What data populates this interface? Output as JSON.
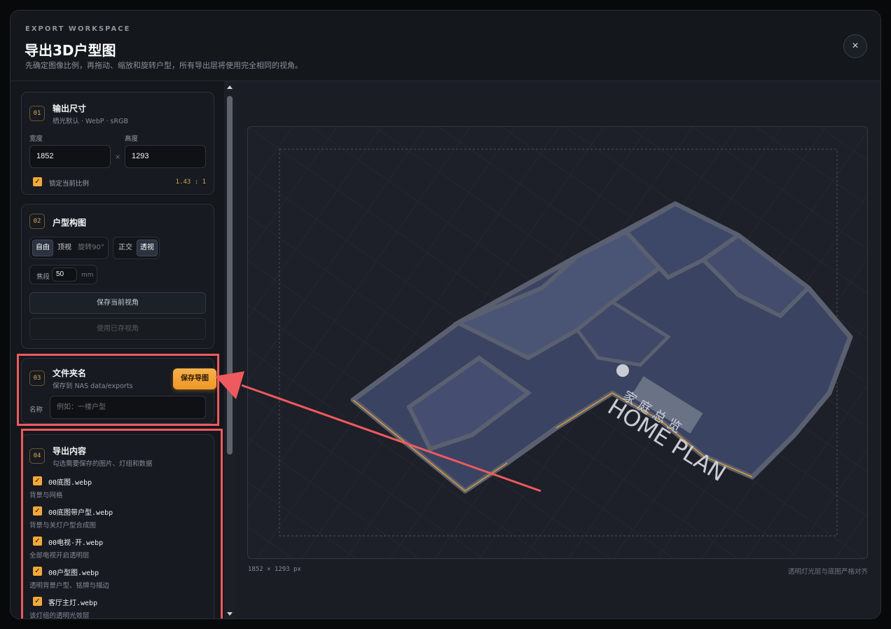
{
  "header": {
    "eyebrow": "EXPORT WORKSPACE",
    "title": "导出3D户型图",
    "subtitle": "先确定图像比例，再拖动、缩放和旋转户型，所有导出层将使用完全相同的视角。",
    "close_label": "×"
  },
  "output_size": {
    "step": "01",
    "title": "输出尺寸",
    "subtitle": "栖光默认 · WebP · sRGB",
    "width_label": "宽度",
    "width_value": "1852",
    "height_label": "高度",
    "height_value": "1293",
    "times": "×",
    "lock_label": "锁定当前比例",
    "lock_checked": true,
    "ratio": "1.43 : 1"
  },
  "composition": {
    "step": "02",
    "title": "户型构图",
    "mode_buttons": [
      "自由",
      "顶视",
      "旋转90°"
    ],
    "active_mode": "自由",
    "projection_buttons": [
      "正交",
      "透视"
    ],
    "active_projection": "透视",
    "focal_label": "焦段",
    "focal_value": "50",
    "focal_unit": "mm",
    "save_view_label": "保存当前视角",
    "use_saved_label": "使用已存视角"
  },
  "folder": {
    "step": "03",
    "title": "文件夹名",
    "subtitle": "保存到 NAS data/exports",
    "save_button": "保存导图",
    "name_label": "名称",
    "name_placeholder": "例如：一楼户型"
  },
  "export_content": {
    "step": "04",
    "title": "导出内容",
    "subtitle": "勾选需要保存的图片、灯组和数据",
    "items": [
      {
        "name": "00底图.webp",
        "desc": "背景与网格",
        "checked": true
      },
      {
        "name": "00底图带户型.webp",
        "desc": "背景与关灯户型合成图",
        "checked": true
      },
      {
        "name": "00电视-开.webp",
        "desc": "全部电视开启透明层",
        "checked": true
      },
      {
        "name": "00户型图.webp",
        "desc": "透明背景户型、铭牌与描边",
        "checked": true
      },
      {
        "name": "客厅主灯.webp",
        "desc": "该灯组的透明光效层",
        "checked": true
      }
    ]
  },
  "preview": {
    "size_text": "1852 × 1293 px",
    "align_text": "透明灯光层与底图严格对齐",
    "nameplate_cn": "家 庭 总 览",
    "nameplate_en": "HOME PLAN"
  },
  "colors": {
    "accent": "#f2a93b",
    "highlight": "#ee5a5e",
    "background": "#14171c"
  }
}
